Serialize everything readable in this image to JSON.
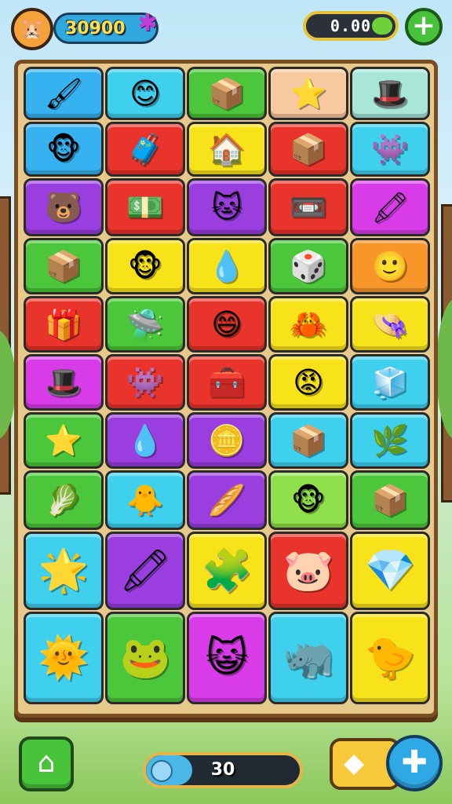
{
  "header": {
    "score": "30900",
    "coins": "0.00",
    "add_label": "+"
  },
  "colors": {
    "blue": "#36b2f0",
    "cyan": "#3fd0ee",
    "green": "#4cc63a",
    "peach": "#f8c9a0",
    "mint": "#a8e6d8",
    "red": "#e8342a",
    "yellow": "#f8e21a",
    "purple": "#9a3ee0",
    "magenta": "#d83ce8",
    "orange": "#f8962a",
    "lime": "#8fe04a"
  },
  "board": {
    "rows": [
      [
        {
          "color": "blue",
          "icon": "brush-icon",
          "glyph": "🖌"
        },
        {
          "color": "cyan",
          "icon": "yellow-blob-icon",
          "glyph": "😊"
        },
        {
          "color": "green",
          "icon": "red-box-icon",
          "glyph": "📦"
        },
        {
          "color": "peach",
          "icon": "star-icon",
          "glyph": "⭐"
        },
        {
          "color": "mint",
          "icon": "orange-hat-icon",
          "glyph": "🎩"
        }
      ],
      [
        {
          "color": "blue",
          "icon": "orange-monkey-icon",
          "glyph": "🐵"
        },
        {
          "color": "red",
          "icon": "blue-chest-icon",
          "glyph": "🧳"
        },
        {
          "color": "yellow",
          "icon": "green-house-icon",
          "glyph": "🏠"
        },
        {
          "color": "red",
          "icon": "blue-box-icon",
          "glyph": "📦"
        },
        {
          "color": "cyan",
          "icon": "purple-critter-icon",
          "glyph": "👾"
        }
      ],
      [
        {
          "color": "purple",
          "icon": "bear-icon",
          "glyph": "🐻"
        },
        {
          "color": "red",
          "icon": "green-cash-box-icon",
          "glyph": "💵"
        },
        {
          "color": "purple",
          "icon": "orange-cat-icon",
          "glyph": "🐱"
        },
        {
          "color": "red",
          "icon": "yellow-tape-icon",
          "glyph": "📼"
        },
        {
          "color": "magenta",
          "icon": "purple-crayon-icon",
          "glyph": "🖍"
        }
      ],
      [
        {
          "color": "green",
          "icon": "red-box-icon",
          "glyph": "📦"
        },
        {
          "color": "yellow",
          "icon": "orange-monkey-icon",
          "glyph": "🐵"
        },
        {
          "color": "yellow",
          "icon": "blue-blob-icon",
          "glyph": "💧"
        },
        {
          "color": "green",
          "icon": "orange-cube-icon",
          "glyph": "🎲"
        },
        {
          "color": "orange",
          "icon": "yellow-monkey-icon",
          "glyph": "🙂"
        }
      ],
      [
        {
          "color": "red",
          "icon": "white-box-icon",
          "glyph": "🎁"
        },
        {
          "color": "green",
          "icon": "green-hat-icon",
          "glyph": "🛸"
        },
        {
          "color": "red",
          "icon": "yellow-face-icon",
          "glyph": "😄"
        },
        {
          "color": "yellow",
          "icon": "red-crab-icon",
          "glyph": "🦀"
        },
        {
          "color": "yellow",
          "icon": "orange-hat-icon",
          "glyph": "👒"
        }
      ],
      [
        {
          "color": "magenta",
          "icon": "orange-hat-icon",
          "glyph": "🎩"
        },
        {
          "color": "red",
          "icon": "purple-critter-icon",
          "glyph": "👾"
        },
        {
          "color": "red",
          "icon": "wooden-crate-icon",
          "glyph": "🧰"
        },
        {
          "color": "yellow",
          "icon": "red-face-icon",
          "glyph": "😡"
        },
        {
          "color": "cyan",
          "icon": "orange-cube-icon",
          "glyph": "🧊"
        }
      ],
      [
        {
          "color": "green",
          "icon": "star-icon",
          "glyph": "⭐"
        },
        {
          "color": "purple",
          "icon": "blue-blob-icon",
          "glyph": "💧"
        },
        {
          "color": "purple",
          "icon": "gold-bar-icon",
          "glyph": "🪙"
        },
        {
          "color": "cyan",
          "icon": "blue-box-icon",
          "glyph": "📦"
        },
        {
          "color": "cyan",
          "icon": "green-figure-icon",
          "glyph": "🌿"
        }
      ],
      [
        {
          "color": "green",
          "icon": "green-hat-icon",
          "glyph": "🥬"
        },
        {
          "color": "cyan",
          "icon": "yellow-critter-icon",
          "glyph": "🐥"
        },
        {
          "color": "purple",
          "icon": "wooden-stick-icon",
          "glyph": "🥖"
        },
        {
          "color": "lime",
          "icon": "orange-monkey-icon",
          "glyph": "🐵"
        },
        {
          "color": "green",
          "icon": "red-box-icon",
          "glyph": "📦"
        }
      ],
      [
        {
          "color": "cyan",
          "icon": "winking-star-icon",
          "glyph": "🌟"
        },
        {
          "color": "purple",
          "icon": "yellow-crayon-icon",
          "glyph": "🖍"
        },
        {
          "color": "yellow",
          "icon": "green-figure-icon",
          "glyph": "🧩"
        },
        {
          "color": "red",
          "icon": "pink-pig-icon",
          "glyph": "🐷"
        },
        {
          "color": "yellow",
          "icon": "blue-gem-icon",
          "glyph": "💎"
        }
      ],
      [
        {
          "color": "cyan",
          "icon": "orange-sun-icon",
          "glyph": "🌞"
        },
        {
          "color": "green",
          "icon": "green-frog-icon",
          "glyph": "🐸"
        },
        {
          "color": "magenta",
          "icon": "purple-cat-icon",
          "glyph": "😺"
        },
        {
          "color": "cyan",
          "icon": "brown-horned-icon",
          "glyph": "🦏"
        },
        {
          "color": "yellow",
          "icon": "yellow-chick-icon",
          "glyph": "🐤"
        }
      ]
    ]
  },
  "footer": {
    "home_icon": "home-icon",
    "progress_value": 30,
    "progress_fraction": 0.3,
    "progress_label": "30",
    "tool_icon": "tag-icon",
    "puzzle_icon": "puzzle-icon"
  }
}
